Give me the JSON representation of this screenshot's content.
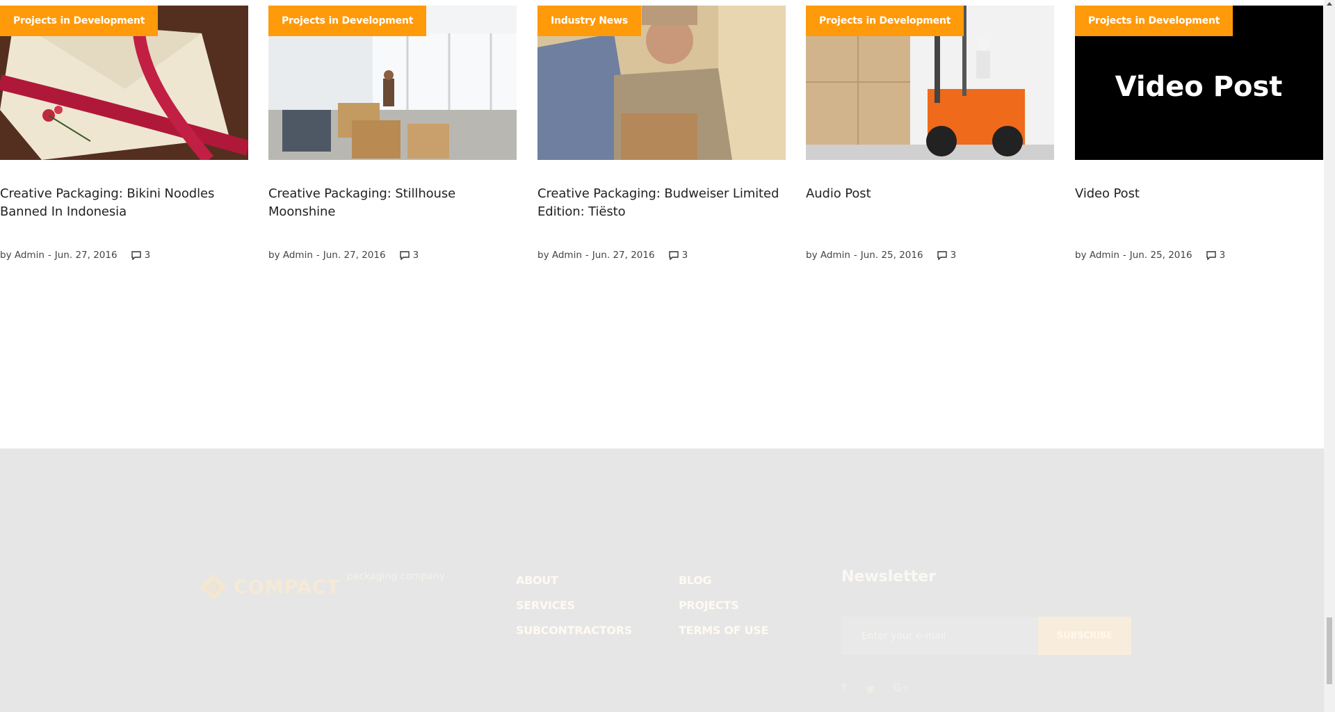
{
  "posts": [
    {
      "category": "Projects in Development",
      "title": "Creative Packaging: Bikini Noodles Banned In Indonesia",
      "by": "by",
      "author": "Admin",
      "date": "Jun. 27, 2016",
      "comments": "3"
    },
    {
      "category": "Projects in Development",
      "title": "Creative Packaging: Stillhouse Moonshine",
      "by": "by",
      "author": "Admin",
      "date": "Jun. 27, 2016",
      "comments": "3"
    },
    {
      "category": "Industry News",
      "title": "Creative Packaging: Budweiser Limited Edition: Tiësto",
      "by": "by",
      "author": "Admin",
      "date": "Jun. 27, 2016",
      "comments": "3"
    },
    {
      "category": "Projects in Development",
      "title": "Audio Post",
      "by": "by",
      "author": "Admin",
      "date": "Jun. 25, 2016",
      "comments": "3"
    },
    {
      "category": "Projects in Development",
      "title": "Video Post",
      "by": "by",
      "author": "Admin",
      "date": "Jun. 25, 2016",
      "comments": "3",
      "thumb_text": "Video Post"
    }
  ],
  "colors": {
    "accent": "#ff9a0a",
    "footer_bg": "#e6e6e6"
  },
  "footer": {
    "logo_text": "COMPACT",
    "tagline": "packaging company",
    "nav_col1": [
      "ABOUT",
      "SERVICES",
      "SUBCONTRACTORS"
    ],
    "nav_col2": [
      "BLOG",
      "PROJECTS",
      "TERMS OF USE"
    ],
    "newsletter_title": "Newsletter",
    "email_placeholder": "Enter your e-mail",
    "subscribe_label": "SUBSCRIBE",
    "social": {
      "facebook": "f",
      "twitter_icon": "twitter-icon",
      "google": "G+"
    }
  }
}
